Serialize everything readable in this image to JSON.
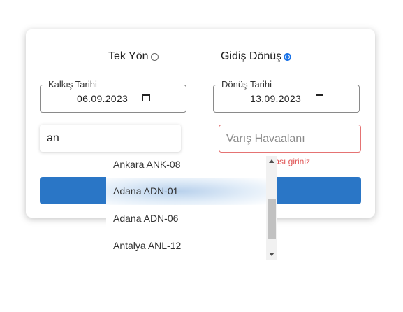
{
  "trip_type": {
    "one_way_label": "Tek Yön",
    "round_trip_label": "Gidiş Dönüş",
    "selected": "Gidiş Dönüş"
  },
  "departure_date": {
    "label": "Kalkış Tarihi",
    "value": "06.09.2023"
  },
  "return_date": {
    "label": "Dönüş Tarihi",
    "value": "13.09.2023"
  },
  "from_airport": {
    "value": "an"
  },
  "to_airport": {
    "placeholder": "Varış Havaalanı",
    "error": "ktası giriniz"
  },
  "search_button": {
    "label": ""
  },
  "dropdown": {
    "items": [
      "Ankara ANK-08",
      "Adana ADN-01",
      "Adana ADN-06",
      "Antalya ANL-12"
    ],
    "highlighted": "Adana ADN-01"
  },
  "colors": {
    "accent": "#1a73e8",
    "button": "#2a76c6",
    "error": "#e05555"
  }
}
